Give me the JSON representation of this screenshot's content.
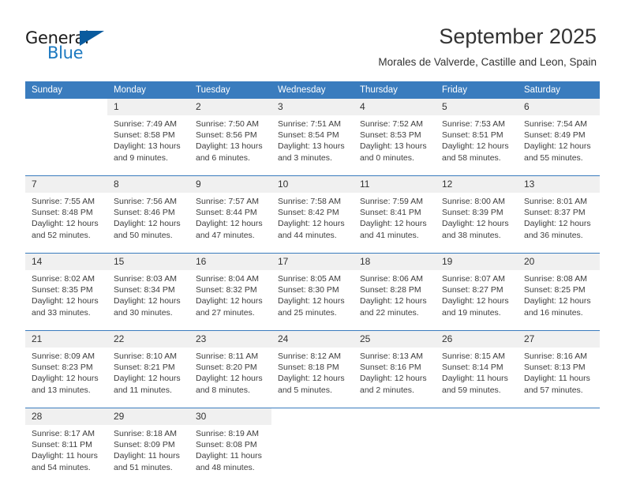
{
  "brand": {
    "name_part1": "General",
    "name_part2": "Blue",
    "accent_color": "#1c79c0",
    "triangle_color": "#0a5b9e"
  },
  "header": {
    "title": "September 2025",
    "subtitle": "Morales de Valverde, Castille and Leon, Spain"
  },
  "theme": {
    "header_row_bg": "#3a7cbe",
    "daynum_bg": "#f0f0f0",
    "text_color": "#333333"
  },
  "calendar": {
    "weekday_headers": [
      "Sunday",
      "Monday",
      "Tuesday",
      "Wednesday",
      "Thursday",
      "Friday",
      "Saturday"
    ],
    "weeks": [
      [
        {
          "day": "",
          "lines": []
        },
        {
          "day": "1",
          "lines": [
            "Sunrise: 7:49 AM",
            "Sunset: 8:58 PM",
            "Daylight: 13 hours",
            "and 9 minutes."
          ]
        },
        {
          "day": "2",
          "lines": [
            "Sunrise: 7:50 AM",
            "Sunset: 8:56 PM",
            "Daylight: 13 hours",
            "and 6 minutes."
          ]
        },
        {
          "day": "3",
          "lines": [
            "Sunrise: 7:51 AM",
            "Sunset: 8:54 PM",
            "Daylight: 13 hours",
            "and 3 minutes."
          ]
        },
        {
          "day": "4",
          "lines": [
            "Sunrise: 7:52 AM",
            "Sunset: 8:53 PM",
            "Daylight: 13 hours",
            "and 0 minutes."
          ]
        },
        {
          "day": "5",
          "lines": [
            "Sunrise: 7:53 AM",
            "Sunset: 8:51 PM",
            "Daylight: 12 hours",
            "and 58 minutes."
          ]
        },
        {
          "day": "6",
          "lines": [
            "Sunrise: 7:54 AM",
            "Sunset: 8:49 PM",
            "Daylight: 12 hours",
            "and 55 minutes."
          ]
        }
      ],
      [
        {
          "day": "7",
          "lines": [
            "Sunrise: 7:55 AM",
            "Sunset: 8:48 PM",
            "Daylight: 12 hours",
            "and 52 minutes."
          ]
        },
        {
          "day": "8",
          "lines": [
            "Sunrise: 7:56 AM",
            "Sunset: 8:46 PM",
            "Daylight: 12 hours",
            "and 50 minutes."
          ]
        },
        {
          "day": "9",
          "lines": [
            "Sunrise: 7:57 AM",
            "Sunset: 8:44 PM",
            "Daylight: 12 hours",
            "and 47 minutes."
          ]
        },
        {
          "day": "10",
          "lines": [
            "Sunrise: 7:58 AM",
            "Sunset: 8:42 PM",
            "Daylight: 12 hours",
            "and 44 minutes."
          ]
        },
        {
          "day": "11",
          "lines": [
            "Sunrise: 7:59 AM",
            "Sunset: 8:41 PM",
            "Daylight: 12 hours",
            "and 41 minutes."
          ]
        },
        {
          "day": "12",
          "lines": [
            "Sunrise: 8:00 AM",
            "Sunset: 8:39 PM",
            "Daylight: 12 hours",
            "and 38 minutes."
          ]
        },
        {
          "day": "13",
          "lines": [
            "Sunrise: 8:01 AM",
            "Sunset: 8:37 PM",
            "Daylight: 12 hours",
            "and 36 minutes."
          ]
        }
      ],
      [
        {
          "day": "14",
          "lines": [
            "Sunrise: 8:02 AM",
            "Sunset: 8:35 PM",
            "Daylight: 12 hours",
            "and 33 minutes."
          ]
        },
        {
          "day": "15",
          "lines": [
            "Sunrise: 8:03 AM",
            "Sunset: 8:34 PM",
            "Daylight: 12 hours",
            "and 30 minutes."
          ]
        },
        {
          "day": "16",
          "lines": [
            "Sunrise: 8:04 AM",
            "Sunset: 8:32 PM",
            "Daylight: 12 hours",
            "and 27 minutes."
          ]
        },
        {
          "day": "17",
          "lines": [
            "Sunrise: 8:05 AM",
            "Sunset: 8:30 PM",
            "Daylight: 12 hours",
            "and 25 minutes."
          ]
        },
        {
          "day": "18",
          "lines": [
            "Sunrise: 8:06 AM",
            "Sunset: 8:28 PM",
            "Daylight: 12 hours",
            "and 22 minutes."
          ]
        },
        {
          "day": "19",
          "lines": [
            "Sunrise: 8:07 AM",
            "Sunset: 8:27 PM",
            "Daylight: 12 hours",
            "and 19 minutes."
          ]
        },
        {
          "day": "20",
          "lines": [
            "Sunrise: 8:08 AM",
            "Sunset: 8:25 PM",
            "Daylight: 12 hours",
            "and 16 minutes."
          ]
        }
      ],
      [
        {
          "day": "21",
          "lines": [
            "Sunrise: 8:09 AM",
            "Sunset: 8:23 PM",
            "Daylight: 12 hours",
            "and 13 minutes."
          ]
        },
        {
          "day": "22",
          "lines": [
            "Sunrise: 8:10 AM",
            "Sunset: 8:21 PM",
            "Daylight: 12 hours",
            "and 11 minutes."
          ]
        },
        {
          "day": "23",
          "lines": [
            "Sunrise: 8:11 AM",
            "Sunset: 8:20 PM",
            "Daylight: 12 hours",
            "and 8 minutes."
          ]
        },
        {
          "day": "24",
          "lines": [
            "Sunrise: 8:12 AM",
            "Sunset: 8:18 PM",
            "Daylight: 12 hours",
            "and 5 minutes."
          ]
        },
        {
          "day": "25",
          "lines": [
            "Sunrise: 8:13 AM",
            "Sunset: 8:16 PM",
            "Daylight: 12 hours",
            "and 2 minutes."
          ]
        },
        {
          "day": "26",
          "lines": [
            "Sunrise: 8:15 AM",
            "Sunset: 8:14 PM",
            "Daylight: 11 hours",
            "and 59 minutes."
          ]
        },
        {
          "day": "27",
          "lines": [
            "Sunrise: 8:16 AM",
            "Sunset: 8:13 PM",
            "Daylight: 11 hours",
            "and 57 minutes."
          ]
        }
      ],
      [
        {
          "day": "28",
          "lines": [
            "Sunrise: 8:17 AM",
            "Sunset: 8:11 PM",
            "Daylight: 11 hours",
            "and 54 minutes."
          ]
        },
        {
          "day": "29",
          "lines": [
            "Sunrise: 8:18 AM",
            "Sunset: 8:09 PM",
            "Daylight: 11 hours",
            "and 51 minutes."
          ]
        },
        {
          "day": "30",
          "lines": [
            "Sunrise: 8:19 AM",
            "Sunset: 8:08 PM",
            "Daylight: 11 hours",
            "and 48 minutes."
          ]
        },
        {
          "day": "",
          "lines": []
        },
        {
          "day": "",
          "lines": []
        },
        {
          "day": "",
          "lines": []
        },
        {
          "day": "",
          "lines": []
        }
      ]
    ]
  }
}
